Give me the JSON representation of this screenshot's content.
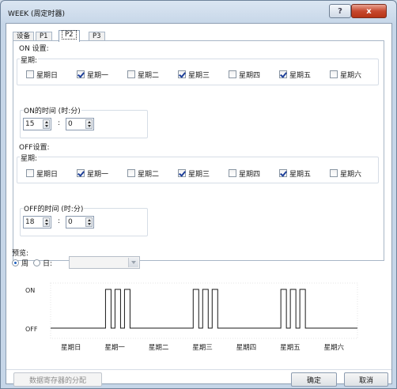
{
  "window": {
    "title": "WEEK (周定时器)"
  },
  "titlebar_buttons": {
    "help": "?",
    "close": "x"
  },
  "tabs": [
    {
      "label": "设备"
    },
    {
      "label": "P1"
    },
    {
      "label": "P2"
    },
    {
      "label": "P3"
    }
  ],
  "active_tab": "P2",
  "on_settings": {
    "label": "ON 设置:",
    "days_label": "星期:",
    "days": [
      {
        "label": "星期日",
        "checked": false
      },
      {
        "label": "星期一",
        "checked": true
      },
      {
        "label": "星期二",
        "checked": false
      },
      {
        "label": "星期三",
        "checked": true
      },
      {
        "label": "星期四",
        "checked": false
      },
      {
        "label": "星期五",
        "checked": true
      },
      {
        "label": "星期六",
        "checked": false
      }
    ],
    "time_label": "ON的时间 (时:分)",
    "hour": "15",
    "minute": "0"
  },
  "off_settings": {
    "label": "OFF设置:",
    "days_label": "星期:",
    "days": [
      {
        "label": "星期日",
        "checked": false
      },
      {
        "label": "星期一",
        "checked": true
      },
      {
        "label": "星期二",
        "checked": false
      },
      {
        "label": "星期三",
        "checked": true
      },
      {
        "label": "星期四",
        "checked": false
      },
      {
        "label": "星期五",
        "checked": true
      },
      {
        "label": "星期六",
        "checked": false
      }
    ],
    "time_label": "OFF的时间 (时:分)",
    "hour": "18",
    "minute": "0"
  },
  "time_separator": ":",
  "preview": {
    "label": "预览:",
    "week_radio": {
      "label": "周",
      "selected": true
    },
    "day_radio": {
      "label": "日:",
      "selected": false
    },
    "day_select_value": ""
  },
  "chart_data": {
    "type": "timing",
    "y_labels": [
      "ON",
      "OFF"
    ],
    "categories": [
      "星期日",
      "星期一",
      "星期二",
      "星期三",
      "星期四",
      "星期五",
      "星期六"
    ],
    "series": [
      {
        "days_active": [
          false,
          true,
          false,
          true,
          false,
          true,
          false
        ],
        "on_time": "15:00",
        "off_time": "18:00",
        "pulses_per_active_day": 3
      }
    ]
  },
  "buttons": {
    "data_register": "数据寄存器的分配",
    "ok": "确定",
    "cancel": "取消"
  }
}
